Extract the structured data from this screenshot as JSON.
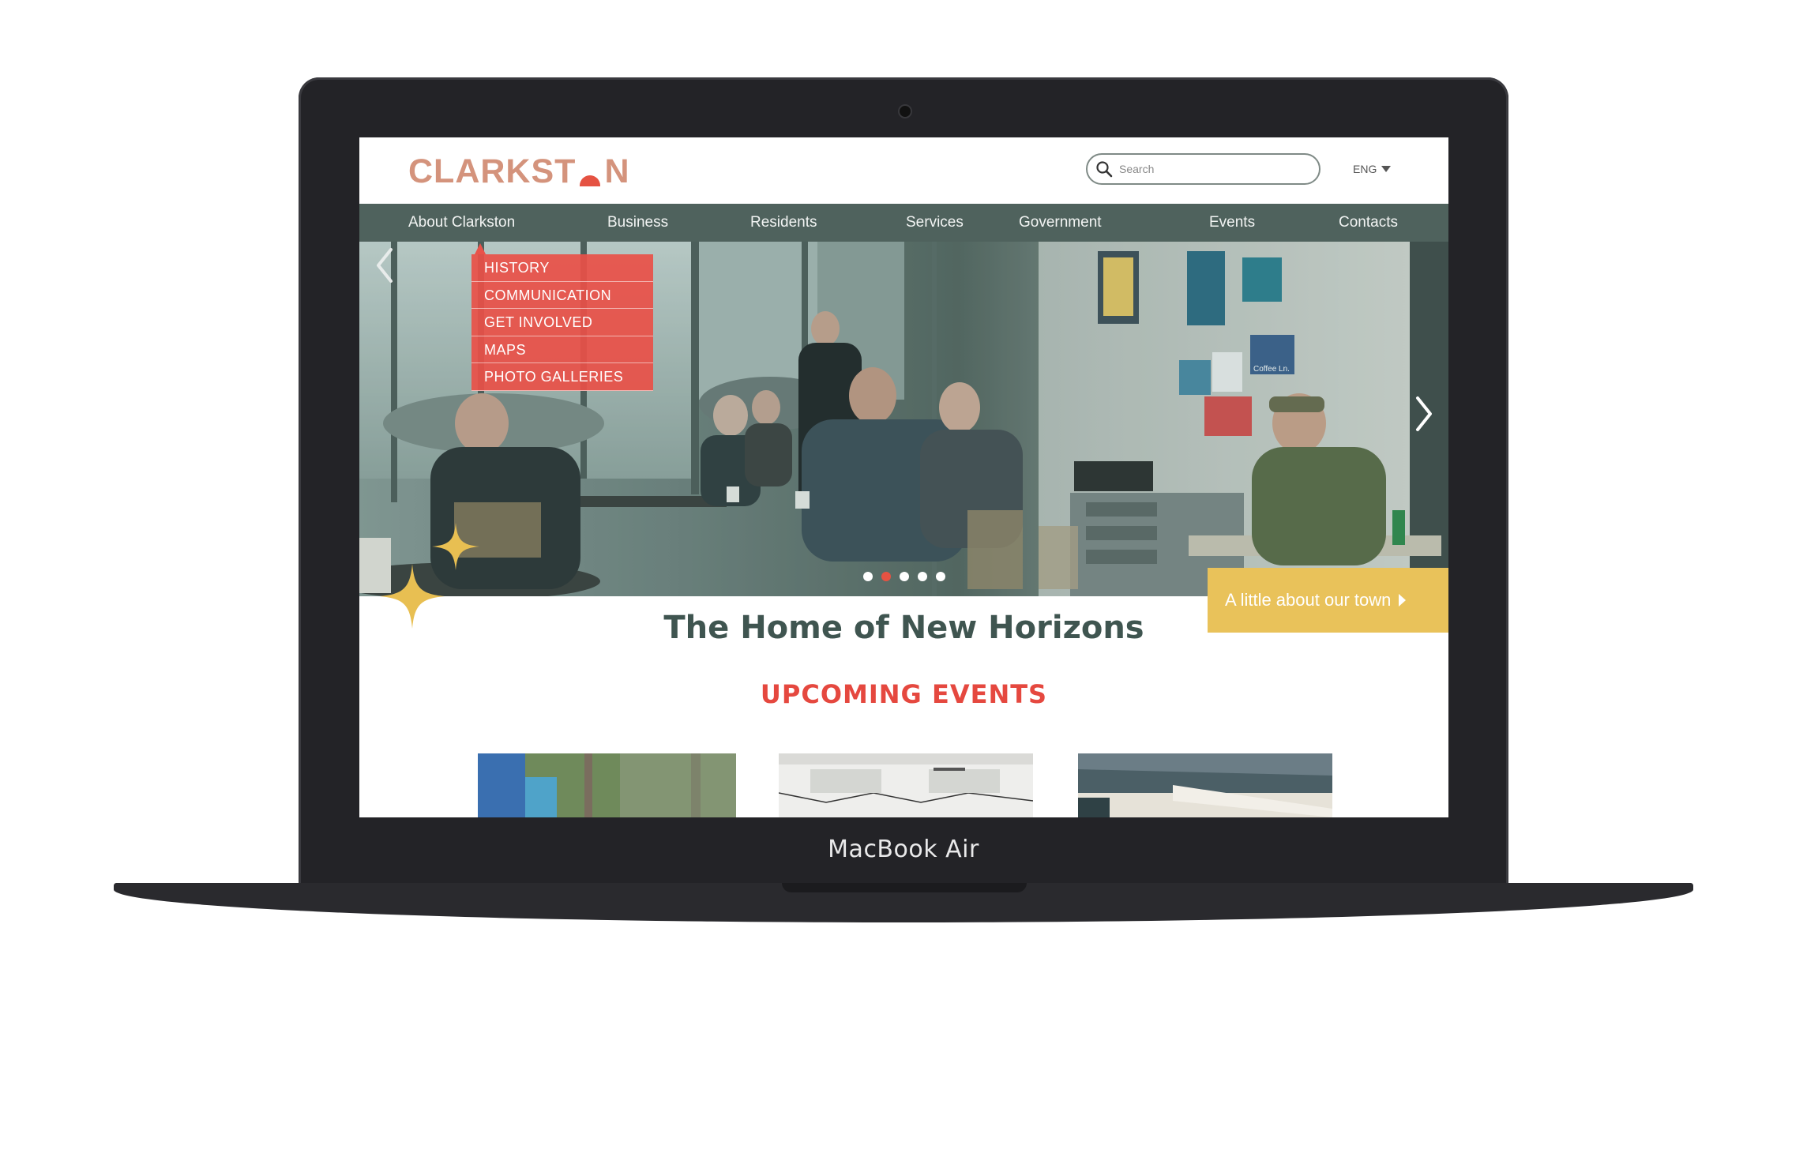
{
  "device": {
    "brand_label": "MacBook Air"
  },
  "site": {
    "logo_text_before": "CLARKST",
    "logo_text_after": "N",
    "search": {
      "placeholder": "Search"
    },
    "language": "ENG",
    "nav": [
      {
        "label": "About  Clarkston"
      },
      {
        "label": "Business"
      },
      {
        "label": "Residents"
      },
      {
        "label": "Services"
      },
      {
        "label": "Government"
      },
      {
        "label": "Events"
      },
      {
        "label": "Contacts"
      }
    ],
    "dropdown": [
      {
        "label": "HISTORY"
      },
      {
        "label": "COMMUNICATION"
      },
      {
        "label": "GET INVOLVED"
      },
      {
        "label": "MAPS"
      },
      {
        "label": "PHOTO GALLERIES"
      }
    ],
    "hero": {
      "cta": "A little about our town",
      "slide_count": 5,
      "active_slide": 2,
      "poster_text": "Coffee Ln."
    },
    "tagline": "The Home of New Horizons",
    "events_heading": "UPCOMING EVENTS"
  },
  "colors": {
    "nav_bg": "#4f625d",
    "accent_red": "#e55242",
    "logo_peach": "#d4937c",
    "cta_yellow": "#e9c25a",
    "title_green": "#3f5550"
  }
}
